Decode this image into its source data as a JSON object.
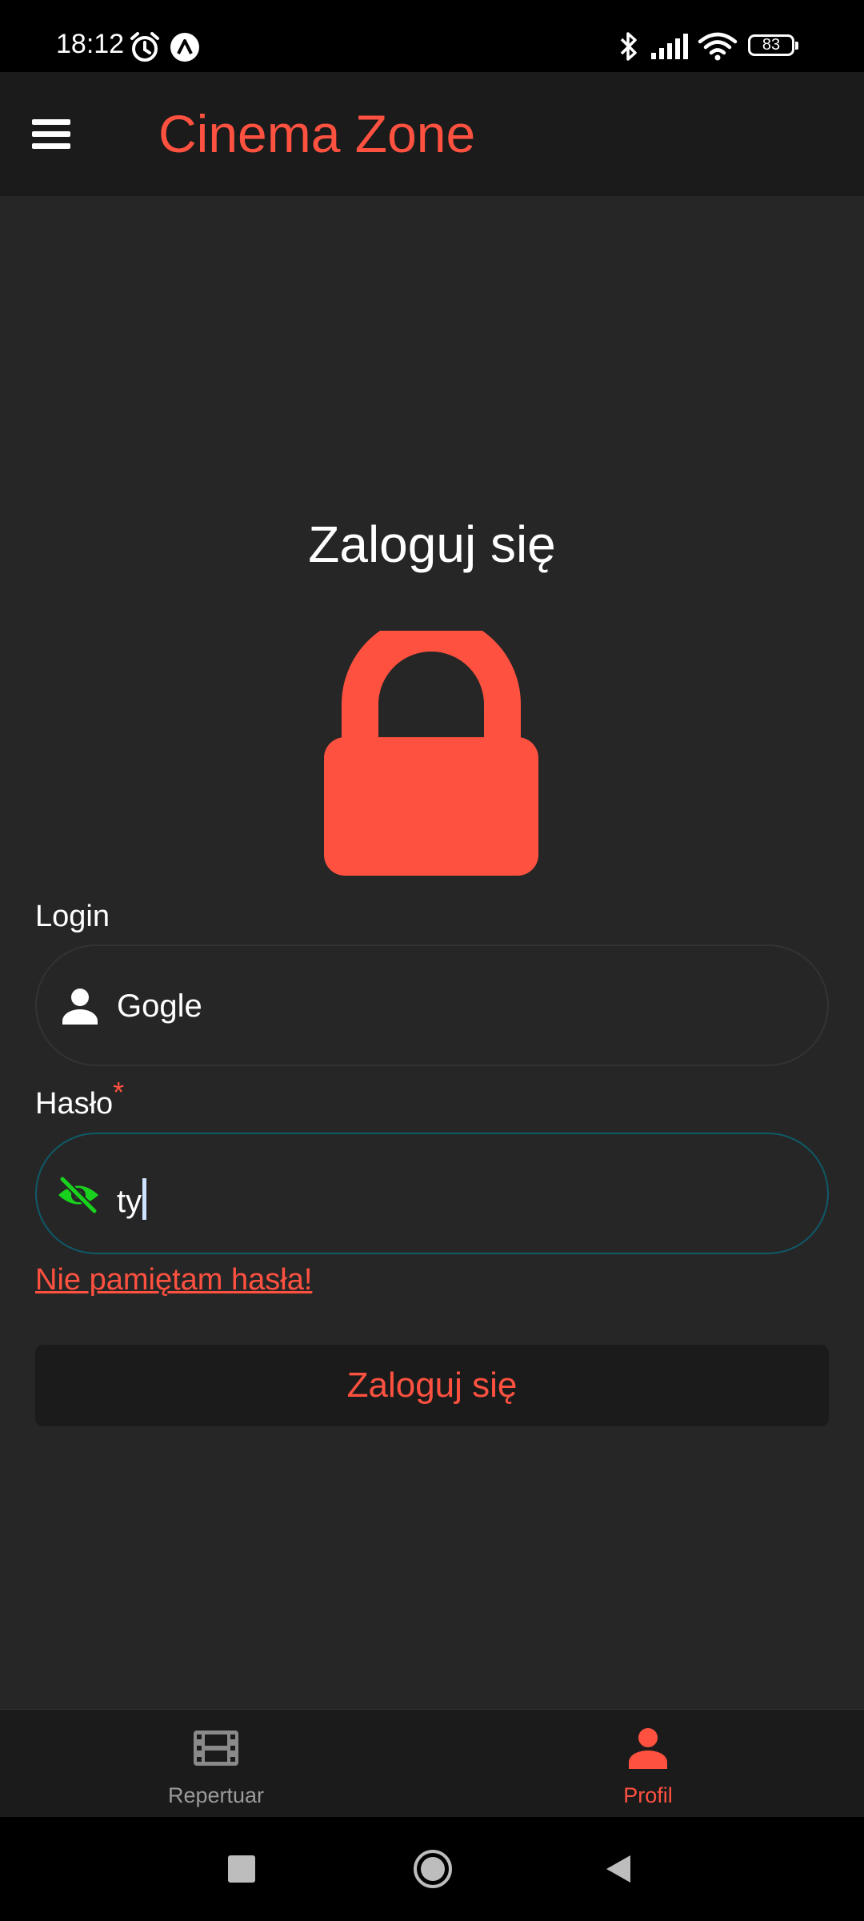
{
  "status_bar": {
    "time": "18:12",
    "battery": "83",
    "icons": [
      "alarm-icon",
      "app-notification-icon",
      "bluetooth-icon",
      "signal-icon",
      "wifi-icon",
      "battery-icon"
    ]
  },
  "app_bar": {
    "title": "Cinema Zone",
    "menu_icon": "hamburger-menu-icon"
  },
  "login_form": {
    "heading": "Zaloguj się",
    "hero_icon": "lock-icon",
    "login": {
      "label": "Login",
      "value": "Gogle",
      "icon": "person-icon"
    },
    "password": {
      "label": "Hasło",
      "required_mark": "*",
      "value": "ty",
      "icon": "eye-off-icon"
    },
    "forgot_password": "Nie pamiętam hasła!",
    "submit": "Zaloguj się"
  },
  "bottom_nav": {
    "items": [
      {
        "label": "Repertuar",
        "icon": "film-icon",
        "active": false
      },
      {
        "label": "Profil",
        "icon": "person-icon",
        "active": true
      }
    ]
  },
  "colors": {
    "accent": "#ff5140",
    "background": "#262626",
    "bar": "#1b1b1b",
    "password_icon": "#19d21d",
    "focus_border": "#0f5a68",
    "inactive_nav": "#9a9a9a"
  },
  "system_nav": [
    "recent-apps-icon",
    "home-icon",
    "back-icon"
  ]
}
